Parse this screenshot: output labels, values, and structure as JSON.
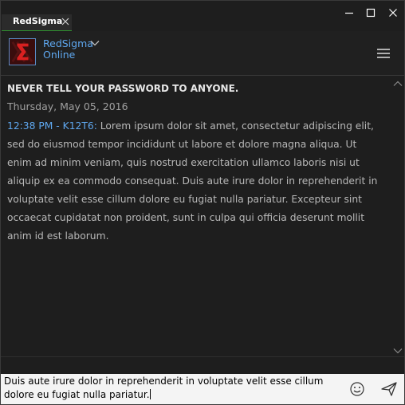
{
  "tab": {
    "label": "RedSigma"
  },
  "contact": {
    "name": "RedSigma",
    "status": "Online"
  },
  "conversation": {
    "warning": "NEVER TELL YOUR PASSWORD TO ANYONE.",
    "date": "Thursday, May 05, 2016",
    "messages": [
      {
        "time_sender": "12:38 PM - K12T6",
        "separator": ": ",
        "text": "Lorem ipsum dolor sit amet, consectetur adipiscing elit, sed do eiusmod tempor incididunt ut labore et dolore magna aliqua. Ut enim ad minim veniam, quis nostrud exercitation ullamco laboris nisi ut aliquip ex ea commodo consequat. Duis aute irure dolor in reprehenderit in voluptate velit esse cillum dolore eu fugiat nulla pariatur. Excepteur sint occaecat cupidatat non proident, sunt in culpa qui officia deserunt mollit anim id est laborum."
      }
    ]
  },
  "compose": {
    "value": "Duis aute irure dolor in reprehenderit in voluptate velit esse cillum dolore eu fugiat nulla pariatur."
  },
  "icons": {
    "tab_close": "close-icon",
    "minimize": "minimize-icon",
    "maximize": "maximize-icon",
    "close": "close-icon",
    "avatar": "sigma-logo",
    "status_dropdown": "chevron-down-icon",
    "menu": "hamburger-menu-icon",
    "scroll_up": "chevron-up-icon",
    "scroll_down": "chevron-down-icon",
    "emoji": "smiley-icon",
    "send": "send-icon"
  },
  "colors": {
    "background": "#1e1e1e",
    "accent": "#5fa8f0",
    "tab_active_underline": "#2f8f2f",
    "compose_background": "#f4f4f4"
  }
}
